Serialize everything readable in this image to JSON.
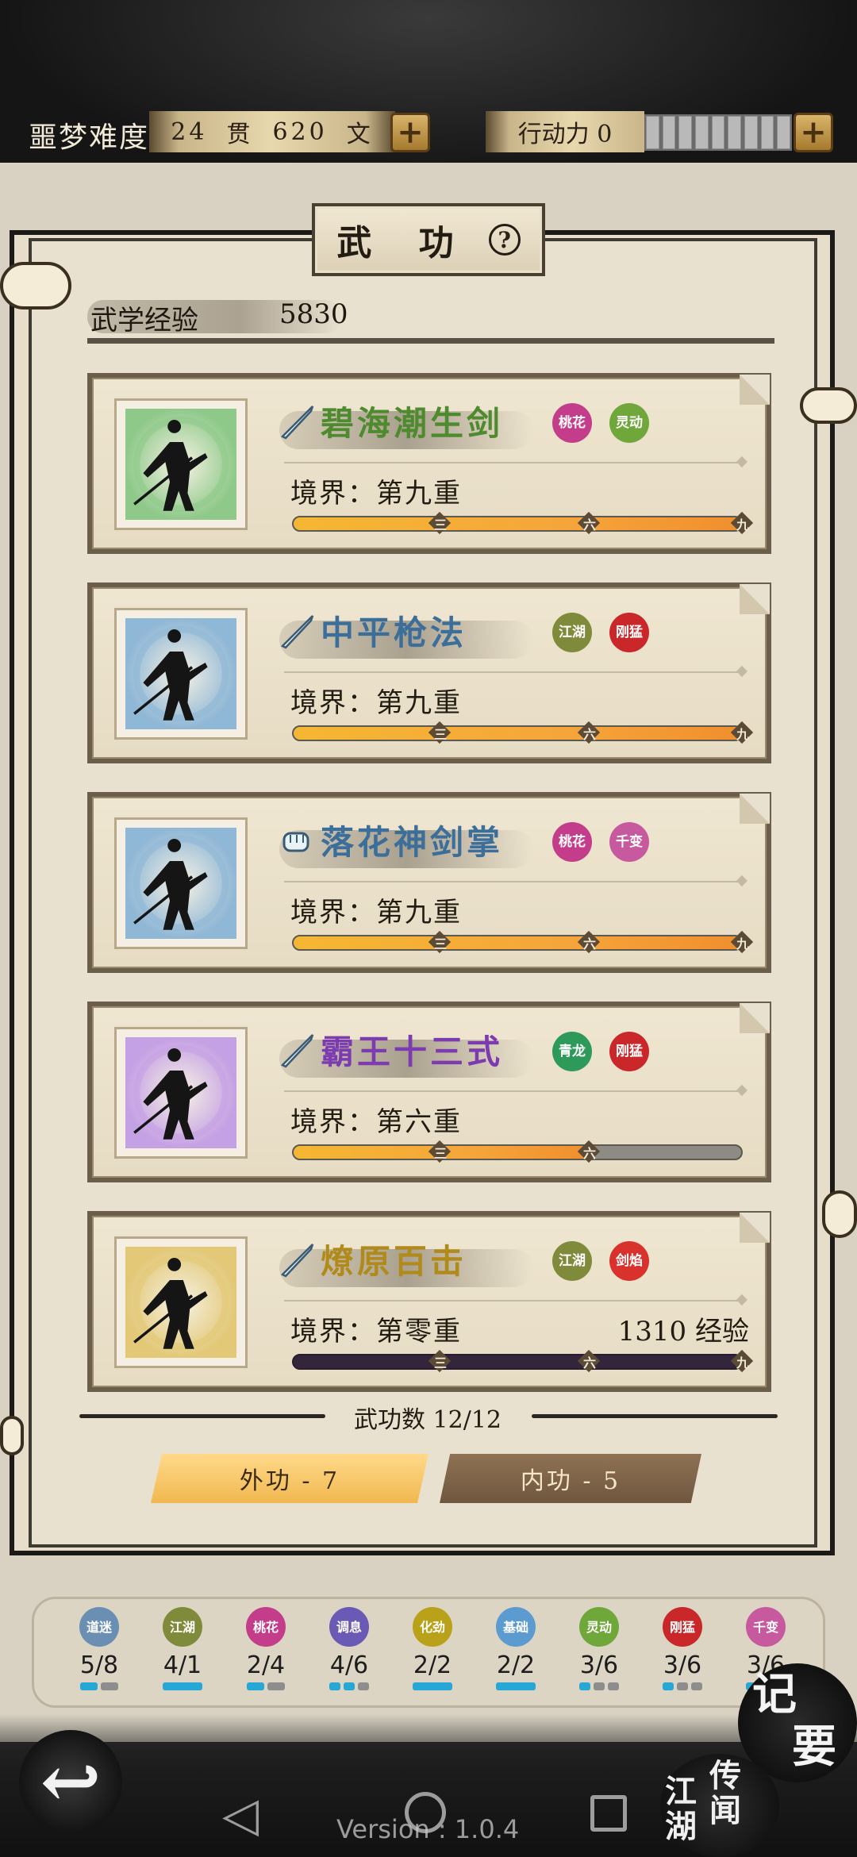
{
  "header": {
    "difficulty_label": "噩梦难度",
    "money_guan": "24",
    "money_guan_unit": "贯",
    "money_wen": "620",
    "money_wen_unit": "文",
    "action_label": "行动力 0",
    "action_segments_total": 9,
    "action_segments_filled": 0
  },
  "panel": {
    "title": "武 功",
    "help_icon": "question-icon",
    "exp_label": "武学经验",
    "exp_value": "5830"
  },
  "skills": [
    {
      "name": "碧海潮生剑",
      "name_color": "#4e8a2e",
      "weapon_icon": "sword-icon",
      "portrait_color": "#8fc98a",
      "tags": [
        {
          "text": "桃花",
          "color": "#c33d8a"
        },
        {
          "text": "灵动",
          "color": "#6fa73a"
        }
      ],
      "realm": "境界：第九重",
      "exp_text": "",
      "progress": 1.0,
      "marks": [
        "三",
        "六",
        "九"
      ]
    },
    {
      "name": "中平枪法",
      "name_color": "#3c6e9a",
      "weapon_icon": "spear-icon",
      "portrait_color": "#8fb7d6",
      "tags": [
        {
          "text": "江湖",
          "color": "#7f8a3a"
        },
        {
          "text": "刚猛",
          "color": "#c9272a"
        }
      ],
      "realm": "境界：第九重",
      "exp_text": "",
      "progress": 1.0,
      "marks": [
        "三",
        "六",
        "九"
      ]
    },
    {
      "name": "落花神剑掌",
      "name_color": "#3c6e9a",
      "weapon_icon": "fist-icon",
      "portrait_color": "#8fb7d6",
      "tags": [
        {
          "text": "桃花",
          "color": "#c33d8a"
        },
        {
          "text": "千变",
          "color": "#c75a9e"
        }
      ],
      "realm": "境界：第九重",
      "exp_text": "",
      "progress": 1.0,
      "marks": [
        "三",
        "六",
        "九"
      ]
    },
    {
      "name": "霸王十三式",
      "name_color": "#7c3cb0",
      "weapon_icon": "spear-icon",
      "portrait_color": "#c4a0e4",
      "tags": [
        {
          "text": "青龙",
          "color": "#2e9a5a"
        },
        {
          "text": "刚猛",
          "color": "#c9272a"
        }
      ],
      "realm": "境界：第六重",
      "exp_text": "",
      "progress": 0.66,
      "marks": [
        "三",
        "六"
      ]
    },
    {
      "name": "燎原百击",
      "name_color": "#b08a1a",
      "weapon_icon": "spear-icon",
      "portrait_color": "#e2c877",
      "tags": [
        {
          "text": "江湖",
          "color": "#7f8a3a"
        },
        {
          "text": "剑焰",
          "color": "#d9322c"
        }
      ],
      "realm": "境界：第零重",
      "exp_text": "1310 经验",
      "progress": 0.0,
      "marks": [
        "三",
        "六",
        "九"
      ]
    }
  ],
  "footer": {
    "skill_count": "武功数 12/12",
    "tab_outer": "外功 - 7",
    "tab_inner": "内功 - 5"
  },
  "traits": [
    {
      "icon": "道迷",
      "color": "#6b8fb3",
      "value": "5/8",
      "bars": [
        1,
        0
      ]
    },
    {
      "icon": "江湖",
      "color": "#7f8a3a",
      "value": "4/1",
      "bars": [
        1
      ]
    },
    {
      "icon": "桃花",
      "color": "#c33d8a",
      "value": "2/4",
      "bars": [
        1,
        0
      ]
    },
    {
      "icon": "调息",
      "color": "#6a5ab5",
      "value": "4/6",
      "bars": [
        1,
        1,
        0
      ]
    },
    {
      "icon": "化劲",
      "color": "#b9a21a",
      "value": "2/2",
      "bars": [
        1
      ]
    },
    {
      "icon": "基础",
      "color": "#5b9bd0",
      "value": "2/2",
      "bars": [
        1
      ]
    },
    {
      "icon": "灵动",
      "color": "#6fa73a",
      "value": "3/6",
      "bars": [
        1,
        0,
        0
      ]
    },
    {
      "icon": "刚猛",
      "color": "#c9272a",
      "value": "3/6",
      "bars": [
        1,
        0,
        0
      ]
    },
    {
      "icon": "千变",
      "color": "#c75a9e",
      "value": "3/6",
      "bars": [
        1,
        0,
        0
      ]
    }
  ],
  "bottom": {
    "jiyao_1": "记",
    "jiyao_2": "要",
    "jianghu_col1": "江湖",
    "jianghu_col2": "传闻",
    "version": "Version : 1.0.4"
  }
}
